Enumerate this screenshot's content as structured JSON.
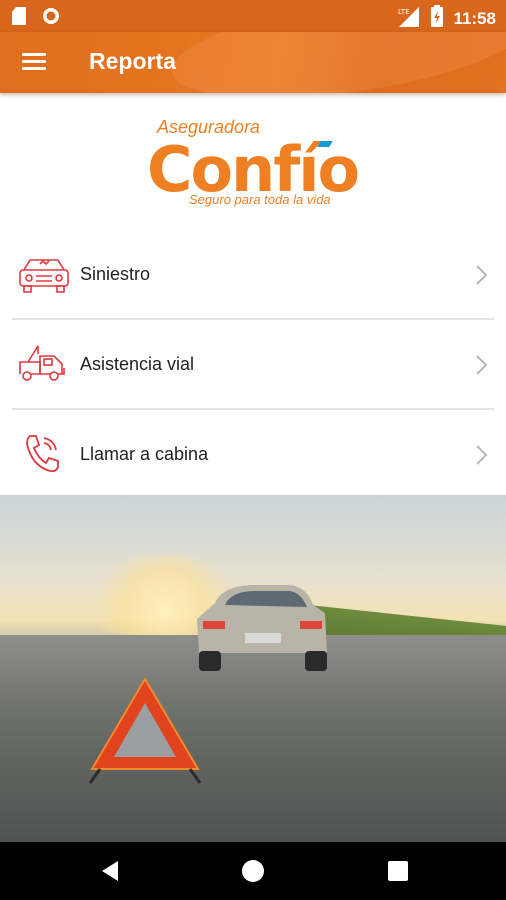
{
  "status_bar": {
    "time": "11:58",
    "network": "LTE",
    "left_icons": [
      "sd-card-icon",
      "record-icon"
    ],
    "right_icons": [
      "signal-icon",
      "battery-icon"
    ]
  },
  "app_bar": {
    "title": "Reporta",
    "menu_icon": "hamburger-menu-icon"
  },
  "logo": {
    "top_text": "Aseguradora",
    "main_text": "Confío",
    "tagline": "Seguro para toda la vida"
  },
  "menu": {
    "items": [
      {
        "label": "Siniestro",
        "icon": "car-crash-icon"
      },
      {
        "label": "Asistencia vial",
        "icon": "tow-truck-icon"
      },
      {
        "label": "Llamar a cabina",
        "icon": "phone-icon"
      }
    ],
    "chevron_icon": "chevron-right-icon"
  },
  "hero": {
    "description_icon": "warning-triangle-road-photo"
  },
  "nav_bar": {
    "buttons": [
      "back-icon",
      "home-icon",
      "recents-icon"
    ]
  },
  "colors": {
    "status_bar": "#d9661b",
    "app_bar": "#e5731f",
    "brand_orange": "#ee7f22",
    "icon_red": "#e0383e",
    "accent_blue": "#1d9bd7",
    "divider": "#e3e3e3"
  }
}
